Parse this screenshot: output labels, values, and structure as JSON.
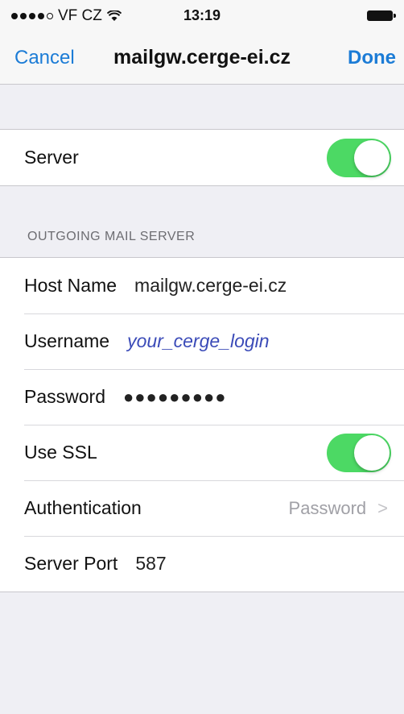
{
  "status_bar": {
    "carrier": "VF CZ",
    "time": "13:19",
    "signal_icon": "signal-dots-icon",
    "wifi_icon": "wifi-icon",
    "battery_icon": "battery-icon"
  },
  "nav": {
    "cancel_label": "Cancel",
    "title": "mailgw.cerge-ei.cz",
    "done_label": "Done"
  },
  "server_toggle": {
    "label": "Server",
    "on": true
  },
  "outgoing": {
    "header": "OUTGOING MAIL SERVER",
    "host_label": "Host Name",
    "host_value": "mailgw.cerge-ei.cz",
    "username_label": "Username",
    "username_value": "your_cerge_login",
    "password_label": "Password",
    "password_value": "●●●●●●●●●",
    "ssl_label": "Use SSL",
    "ssl_on": true,
    "auth_label": "Authentication",
    "auth_value": "Password",
    "port_label": "Server Port",
    "port_value": "587"
  },
  "colors": {
    "accent": "#1c7cd6",
    "toggle_on": "#4cd964",
    "background": "#efeff4"
  }
}
